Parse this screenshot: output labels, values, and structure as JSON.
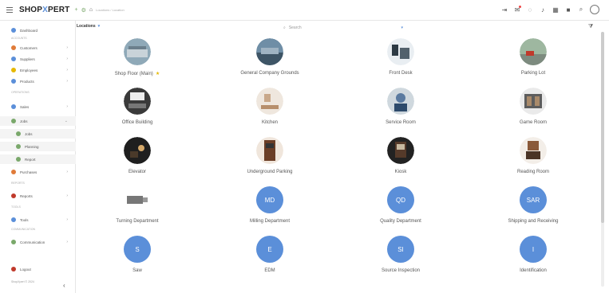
{
  "app": {
    "brand_left": "SHOP",
    "brand_x": "X",
    "brand_right": "PERT",
    "brand_icon_1": "+",
    "brand_icon_2": "⚙",
    "brand_icon_3": "⌂",
    "breadcrumb": "Locations / Location",
    "colors": {
      "accent": "#5b8fd9",
      "avatar_fill": "#5b8fd9"
    }
  },
  "topbar_icons": [
    "login-icon",
    "message-icon",
    "chat-icon",
    "bell-icon",
    "grid-icon",
    "lock-icon",
    "search-icon",
    "user-avatar"
  ],
  "topbar_glyphs": {
    "login": "⇥",
    "message": "✉",
    "chat": "◌",
    "bell": "♪",
    "grid": "▦",
    "lock": "■",
    "search": "⌕"
  },
  "sidebar": {
    "items": [
      {
        "label": "Dashboard",
        "color": "#5b8fd9",
        "chevron": ""
      },
      {
        "section": "Accounts"
      },
      {
        "label": "Customers",
        "color": "#e07b39",
        "chevron": "›"
      },
      {
        "label": "Suppliers",
        "color": "#5b8fd9",
        "chevron": "›"
      },
      {
        "label": "Employees",
        "color": "#e6b800",
        "chevron": "›"
      },
      {
        "label": "Products",
        "color": "#5b8fd9",
        "chevron": "›"
      },
      {
        "section": "Operations"
      },
      {
        "label": "Sales",
        "color": "#5b8fd9",
        "chevron": "›"
      },
      {
        "label": "Jobs",
        "color": "#7aa86b",
        "chevron": "⌄"
      },
      {
        "label": "Jobs",
        "color": "#7aa86b",
        "chevron": "",
        "sub": true
      },
      {
        "label": "Planning",
        "color": "#7aa86b",
        "chevron": "",
        "sub": true
      },
      {
        "label": "Report",
        "color": "#7aa86b",
        "chevron": "",
        "sub": true
      },
      {
        "label": "Purchases",
        "color": "#e07b39",
        "chevron": "›"
      },
      {
        "section": "Reports"
      },
      {
        "label": "Reports",
        "color": "#c0392b",
        "chevron": "›"
      },
      {
        "section": "Tools"
      },
      {
        "label": "Tools",
        "color": "#5b8fd9",
        "chevron": "›"
      },
      {
        "section": "Communication"
      },
      {
        "label": "Communication",
        "color": "#7aa86b",
        "chevron": "›"
      },
      {
        "label": "Logout",
        "color": "#c0392b",
        "chevron": ""
      },
      {
        "label": "ShopXpert © 2024",
        "color": "",
        "chevron": ""
      }
    ],
    "collapse": "‹"
  },
  "toolbar": {
    "location_label": "Locations",
    "location_caret": "▾",
    "search_icon": "⌕",
    "search_placeholder": "Search",
    "search_dropdown": "▾",
    "filter_icon": "⧩"
  },
  "locations": [
    {
      "label": "Shop Floor (Main)",
      "type": "image",
      "pic": "floor",
      "star": "★"
    },
    {
      "label": "General Company Grounds",
      "type": "image",
      "pic": "grounds"
    },
    {
      "label": "Front Desk",
      "type": "image",
      "pic": "desk"
    },
    {
      "label": "Parking Lot",
      "type": "image",
      "pic": "parking"
    },
    {
      "label": "Office Building",
      "type": "image",
      "pic": "office"
    },
    {
      "label": "Kitchen",
      "type": "image",
      "pic": "kitchen"
    },
    {
      "label": "Service Room",
      "type": "image",
      "pic": "service"
    },
    {
      "label": "Game Room",
      "type": "image",
      "pic": "game"
    },
    {
      "label": "Elevator",
      "type": "image",
      "pic": "elevator"
    },
    {
      "label": "Underground Parking",
      "type": "image",
      "pic": "underground"
    },
    {
      "label": "Kiosk",
      "type": "image",
      "pic": "kiosk"
    },
    {
      "label": "Reading Room",
      "type": "image",
      "pic": "reading"
    },
    {
      "label": "Turning Department",
      "type": "image",
      "pic": "turning"
    },
    {
      "label": "Milling Department",
      "type": "initials",
      "initials": "MD"
    },
    {
      "label": "Quality Department",
      "type": "initials",
      "initials": "QD"
    },
    {
      "label": "Shipping and Receiving",
      "type": "initials",
      "initials": "SAR"
    },
    {
      "label": "Saw",
      "type": "initials",
      "initials": "S"
    },
    {
      "label": "EDM",
      "type": "initials",
      "initials": "E"
    },
    {
      "label": "Source Inspection",
      "type": "initials",
      "initials": "SI"
    },
    {
      "label": "Identification",
      "type": "initials",
      "initials": "I"
    }
  ]
}
